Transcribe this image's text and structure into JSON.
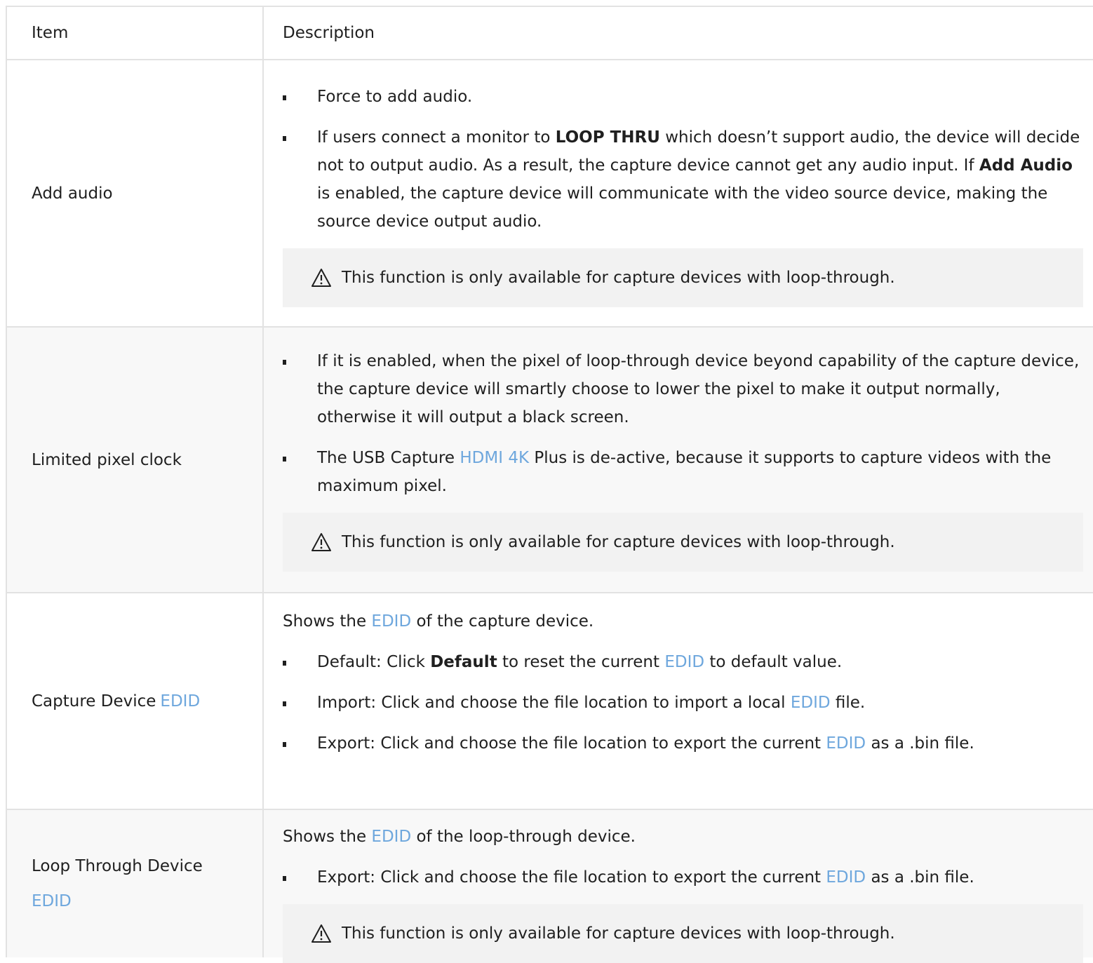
{
  "header": {
    "item": "Item",
    "description": "Description"
  },
  "rows": [
    {
      "item": "Add audio",
      "bullets": {
        "b1": "Force to add audio.",
        "b2_pre": "If users connect a monitor to ",
        "b2_bold": "LOOP THRU",
        "b2_mid": " which doesn’t support audio, the device will decide not to output audio. As a result, the capture device cannot get any audio input. If ",
        "b2_bold2": "Add Audio",
        "b2_post": " is enabled, the capture device will communicate with the video source device, making the source device output audio."
      },
      "note": "This function is only available for capture devices with loop-through."
    },
    {
      "item": "Limited pixel clock",
      "bullets": {
        "b1": "If it is enabled, when the pixel of loop-through device beyond capability of the capture device, the capture device will smartly choose to lower the pixel to make it output normally, otherwise it will output a black screen.",
        "b2_pre": "The USB Capture ",
        "b2_link": "HDMI 4K",
        "b2_post": " Plus is de-active, because it supports to capture videos with the maximum pixel."
      },
      "note": "This function is only available for capture devices with loop-through."
    },
    {
      "item_pre": "Capture Device ",
      "item_link": "EDID",
      "intro_pre": "Shows the ",
      "intro_link": "EDID",
      "intro_post": " of the capture device.",
      "bullets": {
        "b1_pre": "Default: Click ",
        "b1_bold": "Default",
        "b1_mid": " to reset the current ",
        "b1_link": "EDID",
        "b1_post": " to default value.",
        "b2_pre": "Import: Click and choose the file location to import a local ",
        "b2_link": "EDID",
        "b2_post": " file.",
        "b3_pre": "Export: Click and choose the file location to export the current ",
        "b3_link": "EDID",
        "b3_post": " as a .bin file."
      }
    },
    {
      "item_pre": "Loop Through Device",
      "item_link": "EDID",
      "intro_pre": "Shows the ",
      "intro_link": "EDID",
      "intro_post": " of the loop-through device.",
      "bullets": {
        "b1_pre": "Export: Click and choose the file location to export the current ",
        "b1_link": "EDID",
        "b1_post": " as a .bin file."
      },
      "note": "This function is only available for capture devices with loop-through."
    }
  ],
  "icons": {
    "warning": "warning-triangle-icon"
  },
  "colors": {
    "link": "#6ea7dd",
    "note_bg": "#f2f2f2",
    "row_shade": "#f8f8f8"
  }
}
